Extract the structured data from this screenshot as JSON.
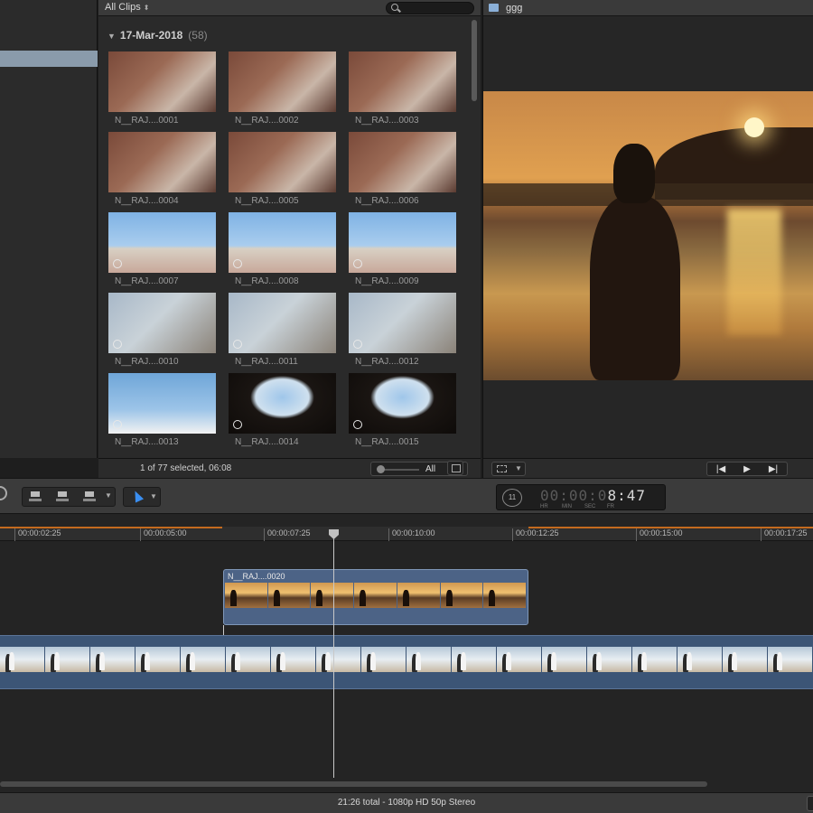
{
  "browser": {
    "filter_label": "All Clips",
    "event": {
      "date": "17-Mar-2018",
      "count": "(58)"
    },
    "clips": [
      {
        "label": "N__RAJ....0001",
        "scene": "wall"
      },
      {
        "label": "N__RAJ....0002",
        "scene": "wall"
      },
      {
        "label": "N__RAJ....0003",
        "scene": "wall"
      },
      {
        "label": "N__RAJ....0004",
        "scene": "wall"
      },
      {
        "label": "N__RAJ....0005",
        "scene": "wall"
      },
      {
        "label": "N__RAJ....0006",
        "scene": "wall"
      },
      {
        "label": "N__RAJ....0007",
        "scene": "lighthouse"
      },
      {
        "label": "N__RAJ....0008",
        "scene": "lighthouse"
      },
      {
        "label": "N__RAJ....0009",
        "scene": "lighthouse"
      },
      {
        "label": "N__RAJ....0010",
        "scene": "tower"
      },
      {
        "label": "N__RAJ....0011",
        "scene": "tower"
      },
      {
        "label": "N__RAJ....0012",
        "scene": "tower"
      },
      {
        "label": "N__RAJ....0013",
        "scene": "sky"
      },
      {
        "label": "N__RAJ....0014",
        "scene": "arch"
      },
      {
        "label": "N__RAJ....0015",
        "scene": "arch"
      }
    ],
    "selection_status": "1 of 77 selected, 06:08",
    "zoom_label": "All"
  },
  "viewer": {
    "title": "ggg"
  },
  "toolbar": {
    "timecode": {
      "dim": "00:00:0",
      "bright": "8:47",
      "badge": "11",
      "units": [
        "HR",
        "MIN",
        "SEC",
        "FR"
      ]
    }
  },
  "timeline": {
    "ticks": [
      "00:00:02:25",
      "00:00:05:00",
      "00:00:07:25",
      "00:00:10:00",
      "00:00:12:25",
      "00:00:15:00",
      "00:00:17:25"
    ],
    "connected_clip_name": "N__RAJ....0020",
    "status": "21:26 total - 1080p HD 50p Stereo"
  },
  "colors": {
    "selection_accent": "#8a9bab",
    "clip_blue": "#4c6386",
    "range_orange": "#c46a1e",
    "select_tool_blue": "#3a8ef0"
  }
}
